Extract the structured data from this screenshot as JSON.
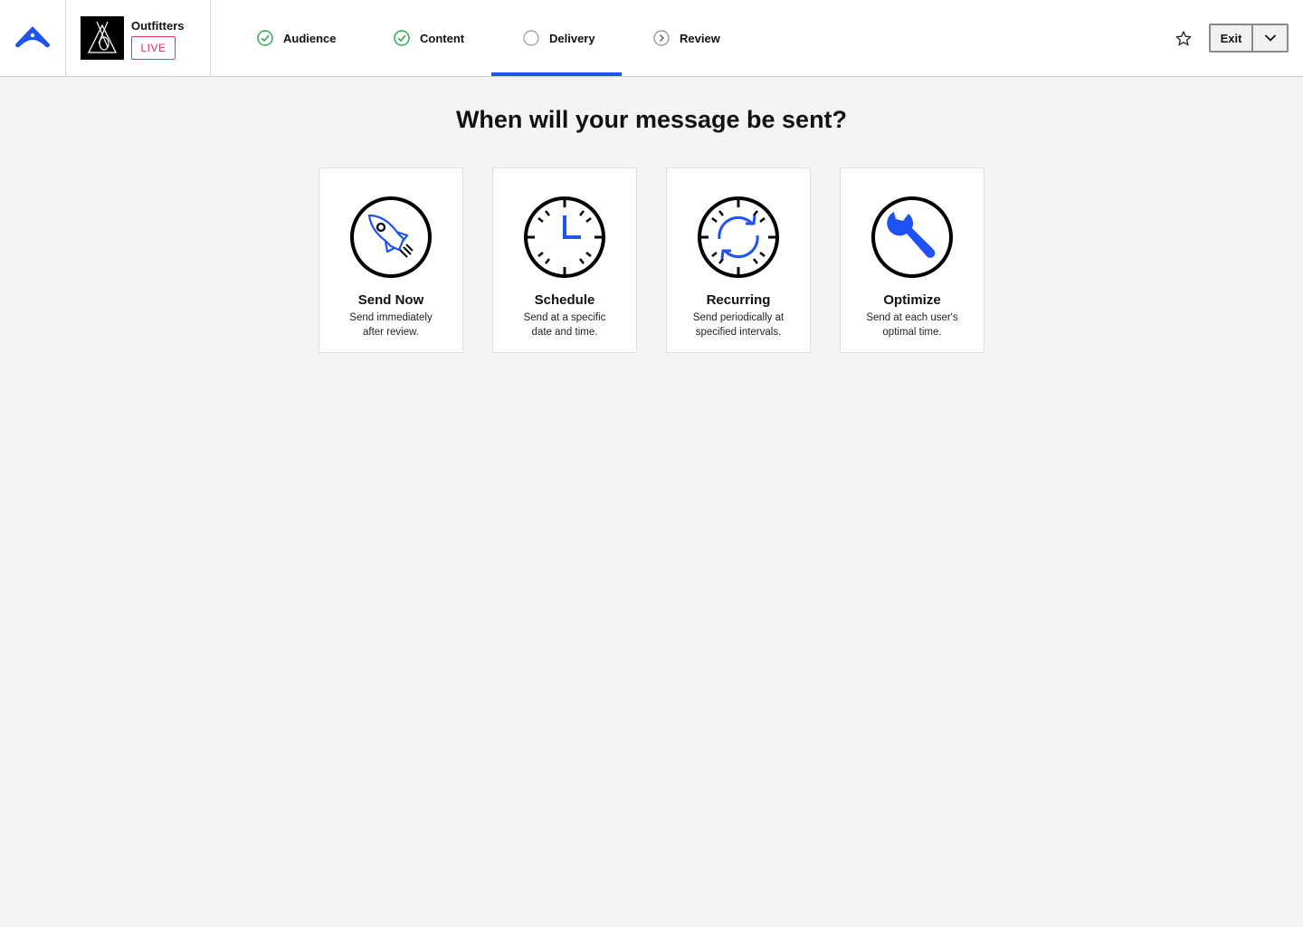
{
  "app": {
    "name": "Outfitters",
    "status_badge": "LIVE"
  },
  "steps": [
    {
      "label": "Audience",
      "state": "complete"
    },
    {
      "label": "Content",
      "state": "complete"
    },
    {
      "label": "Delivery",
      "state": "current"
    },
    {
      "label": "Review",
      "state": "upcoming"
    }
  ],
  "header": {
    "exit_label": "Exit"
  },
  "main": {
    "heading": "When will your message be sent?",
    "options": [
      {
        "title": "Send Now",
        "desc_line1": "Send immediately",
        "desc_line2": "after review.",
        "icon": "rocket-icon"
      },
      {
        "title": "Schedule",
        "desc_line1": "Send at a specific",
        "desc_line2": "date and time.",
        "icon": "clock-icon"
      },
      {
        "title": "Recurring",
        "desc_line1": "Send periodically at",
        "desc_line2": "specified intervals.",
        "icon": "recurring-icon"
      },
      {
        "title": "Optimize",
        "desc_line1": "Send at each user's",
        "desc_line2": "optimal time.",
        "icon": "wrench-icon"
      }
    ]
  },
  "colors": {
    "accent": "#1f52f2",
    "complete": "#2fa84f",
    "live": "#d8326a",
    "background": "#f4f4f4"
  }
}
